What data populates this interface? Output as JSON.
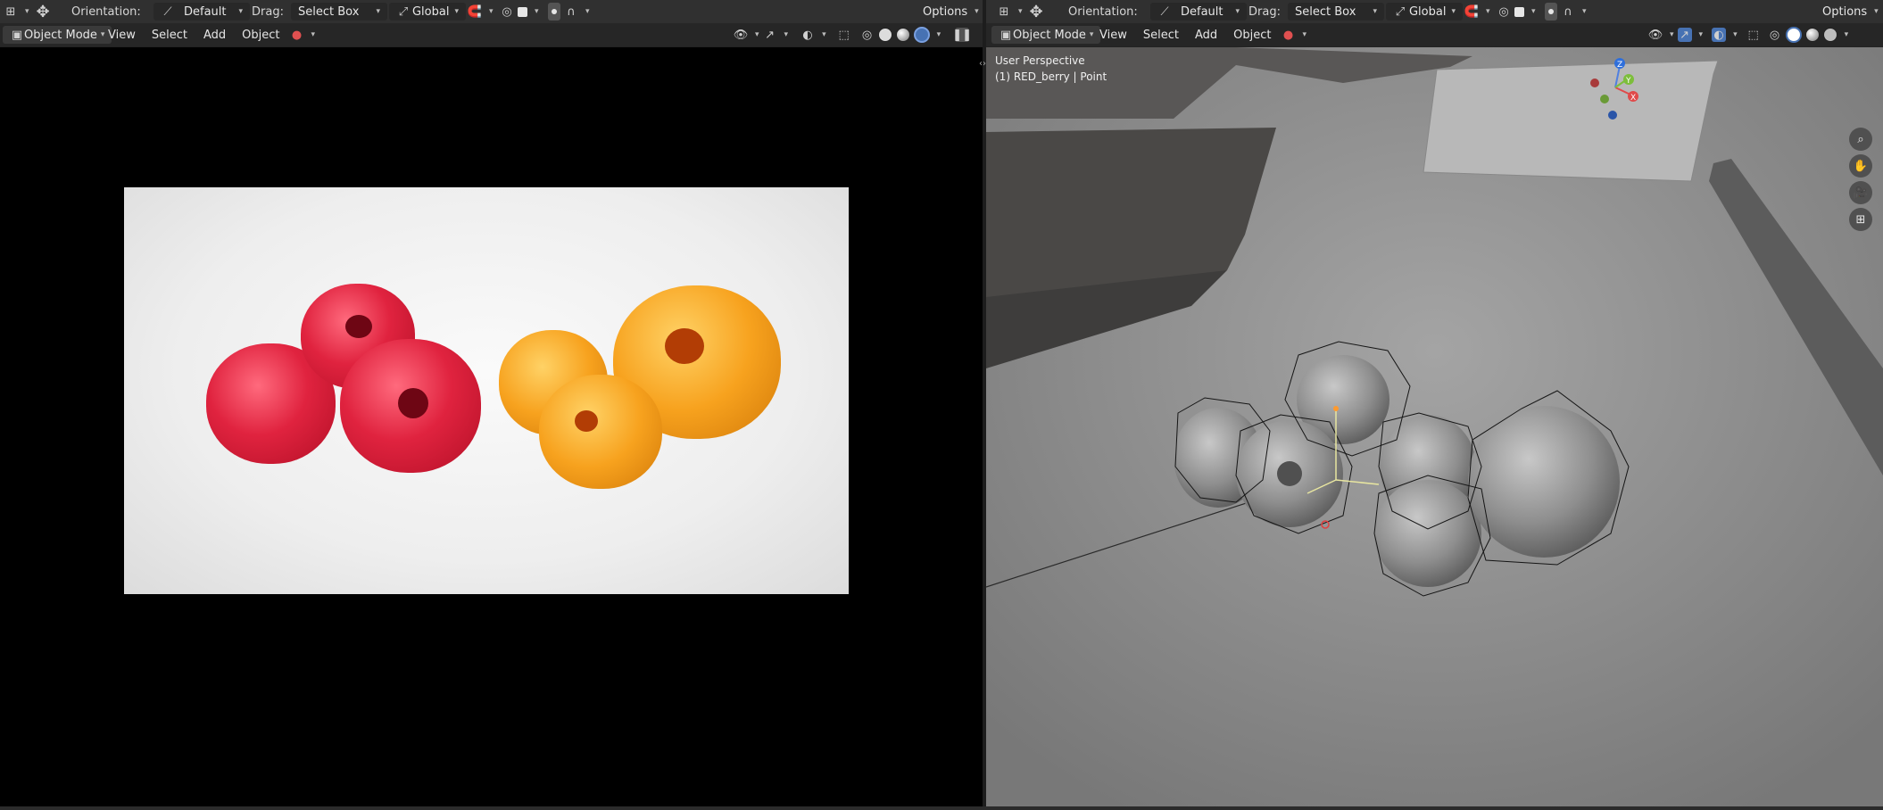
{
  "header": {
    "orientation_label": "Orientation:",
    "orientation_value": "Default",
    "drag_label": "Drag:",
    "drag_value": "Select Box",
    "transform_pivot": "Global",
    "options_label": "Options"
  },
  "left_editor": {
    "mode": "Object Mode",
    "menus": [
      "View",
      "Select",
      "Add",
      "Object"
    ]
  },
  "right_editor": {
    "mode": "Object Mode",
    "menus": [
      "View",
      "Select",
      "Add",
      "Object"
    ],
    "viewport": {
      "perspective": "User Perspective",
      "active_object": "(1) RED_berry | Point"
    },
    "gizmo_axes": [
      "X",
      "Y",
      "Z"
    ]
  },
  "icons": [
    "editor-type-icon",
    "move-tool-icon",
    "orientation-icon",
    "snap-icon",
    "proportional-edit-icon",
    "visibility-icon",
    "gizmo-icon",
    "overlay-icon",
    "xray-icon",
    "shading-wireframe-icon",
    "shading-solid-icon",
    "shading-material-icon",
    "shading-rendered-icon",
    "pause-icon",
    "zoom-icon",
    "hand-icon",
    "camera-icon",
    "grid-icon"
  ],
  "colors": {
    "header_bg": "#303030",
    "button_bg": "#545454",
    "active_blue": "#4772b3",
    "viewport_gray": "#7d7d7d",
    "berry_red": "#e0233f",
    "berry_orange": "#f7a21e"
  }
}
